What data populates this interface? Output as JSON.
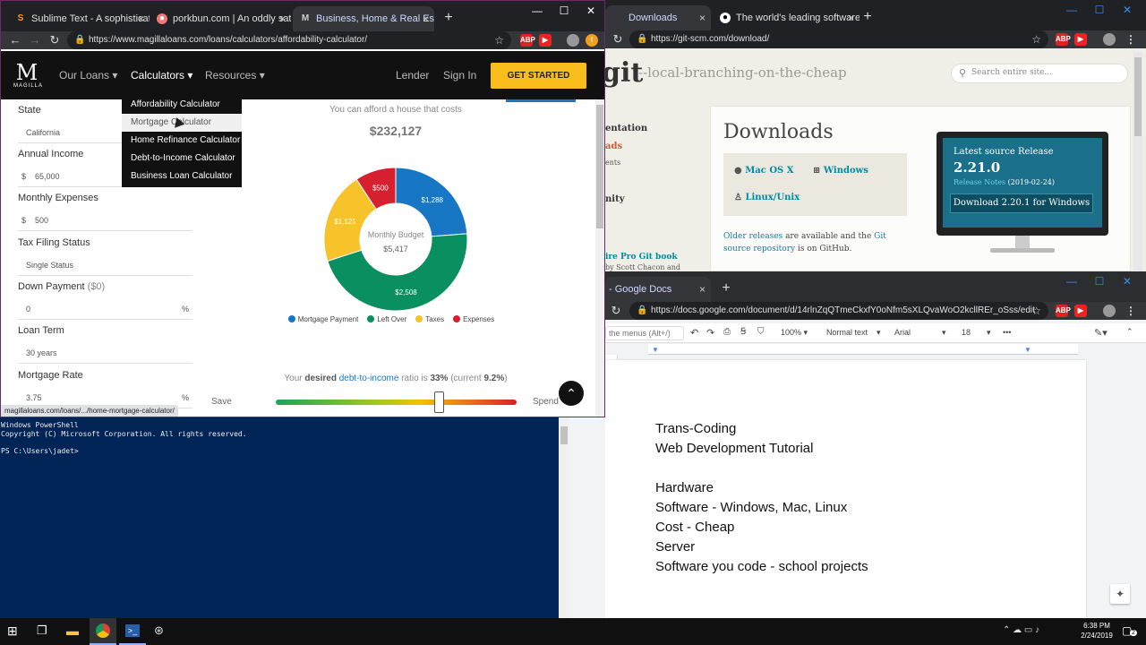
{
  "magilla_window": {
    "tabs": [
      {
        "label": "Sublime Text - A sophisticated te",
        "favicon": "S",
        "color": "#f79a1f"
      },
      {
        "label": "porkbun.com | An oddly satisfyi",
        "favicon": "p",
        "color": "#ef7878"
      },
      {
        "label": "Business, Home & Real Estate Lo",
        "favicon": "M",
        "color": "#444444"
      }
    ],
    "url": "https://www.magillaloans.com/loans/calculators/affordability-calculator/",
    "logo": {
      "mark": "M",
      "text": "MAGILLA"
    },
    "nav": {
      "our_loans": "Our Loans",
      "calculators": "Calculators",
      "resources": "Resources",
      "lender": "Lender",
      "sign_in": "Sign In",
      "get_started": "GET STARTED"
    },
    "dropdown": [
      "Affordability Calculator",
      "Mortgage Calculator",
      "Home Refinance Calculator",
      "Debt-to-Income Calculator",
      "Business Loan Calculator"
    ],
    "form": {
      "state_label": "State",
      "state_value": "California",
      "income_label": "Annual Income",
      "income_prefix": "$",
      "income_value": "65,000",
      "expenses_label": "Monthly Expenses",
      "expenses_prefix": "$",
      "expenses_value": "500",
      "tax_label": "Tax Filing Status",
      "tax_value": "Single Status",
      "down_label": "Down Payment",
      "down_hint": "($0)",
      "down_value": "0",
      "down_suffix": "%",
      "term_label": "Loan Term",
      "term_value": "30 years",
      "rate_label": "Mortgage Rate",
      "rate_value": "3.75",
      "rate_suffix": "%"
    },
    "result": {
      "afford_text": "You can afford a house that costs",
      "price": "$232,127"
    },
    "chart_data": {
      "type": "pie",
      "categories": [
        "Mortgage Payment",
        "Left Over",
        "Taxes",
        "Expenses"
      ],
      "values": [
        1288,
        2508,
        1121,
        500
      ],
      "labels": [
        "$1,288",
        "$2,508",
        "$1,121",
        "$500"
      ],
      "colors": [
        "#1877c4",
        "#0a8f60",
        "#f6c32b",
        "#d6202f"
      ],
      "center_title": "Monthly Budget",
      "center_value": "$5,417",
      "legend_position": "bottom"
    },
    "dti": {
      "prefix": "Your ",
      "desired": "desired",
      "link": "debt-to-income",
      "middle": " ratio is ",
      "value": "33%",
      "current_prefix": " (current ",
      "current": "9.2%",
      "current_suffix": ")",
      "save": "Save",
      "spend": "Spend",
      "slider_level": 0.68
    },
    "status_url": "magillaloans.com/loans/.../home-mortgage-calculator/"
  },
  "git_window": {
    "tabs": [
      {
        "label": "Downloads"
      },
      {
        "label": "The world's leading software de"
      }
    ],
    "url": "https://git-scm.com/download/",
    "logo": "git",
    "tagline": "--local-branching-on-the-cheap",
    "search_placeholder": "Search entire site...",
    "sidebar": [
      "entation",
      "ads",
      "ents",
      "nity"
    ],
    "pro_git": "ire Pro Git book",
    "pro_git_by": "by Scott Chacon and",
    "downloads_title": "Downloads",
    "os": [
      "Mac OS X",
      "Windows",
      "Linux/Unix"
    ],
    "older_link": "Older releases",
    "older_text": " are available and the ",
    "source_link": "Git source repository",
    "source_text": " is on GitHub.",
    "release_title": "Latest source Release",
    "release_version": "2.21.0",
    "release_notes": "Release Notes",
    "release_date": "(2019-02-24)",
    "download_button": "Download 2.20.1 for Windows"
  },
  "docs_window": {
    "tab": "- Google Docs",
    "url": "https://docs.google.com/document/d/14rlnZqQTmeCkxfY0oNfm5sXLQvaWoO2kcllREr_oSss/edit",
    "menus_hint": "the menus (Alt+/)",
    "zoom": "100%",
    "style": "Normal text",
    "font": "Arial",
    "size": "18",
    "more": "•••",
    "lines": [
      "Trans-Coding",
      "Web Development Tutorial",
      "",
      "Hardware",
      "Software - Windows, Mac, Linux",
      "Cost - Cheap",
      "Server",
      "Software you code - school projects"
    ]
  },
  "powershell": {
    "lines": [
      "Windows PowerShell",
      "Copyright (C) Microsoft Corporation. All rights reserved.",
      "",
      "PS C:\\Users\\jadet>"
    ]
  },
  "taskbar": {
    "time": "6:38 PM",
    "date": "2/24/2019",
    "notifications": "2"
  }
}
